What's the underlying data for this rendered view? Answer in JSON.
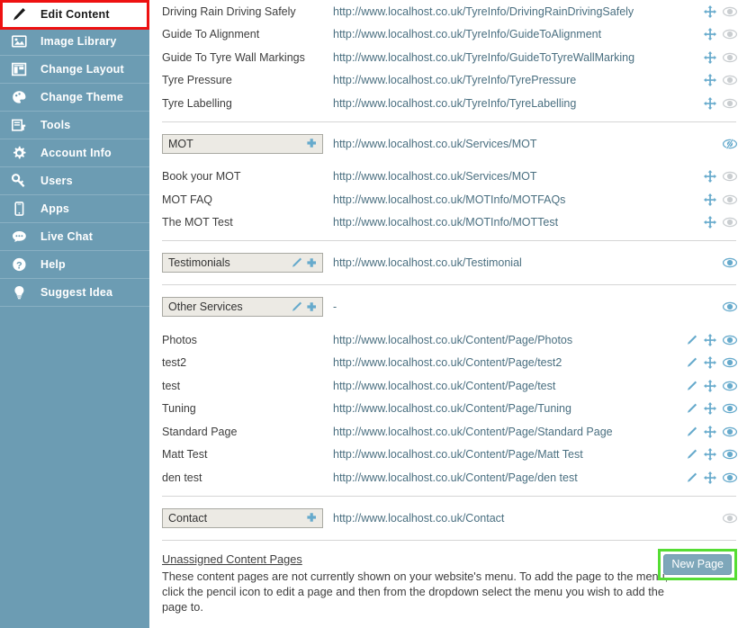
{
  "sidebar": {
    "items": [
      {
        "label": "Edit Content",
        "icon": "pencil-icon",
        "active": true
      },
      {
        "label": "Image Library",
        "icon": "image-icon",
        "active": false
      },
      {
        "label": "Change Layout",
        "icon": "layout-icon",
        "active": false
      },
      {
        "label": "Change Theme",
        "icon": "paint-icon",
        "active": false
      },
      {
        "label": "Tools",
        "icon": "tools-icon",
        "active": false
      },
      {
        "label": "Account Info",
        "icon": "gear-icon",
        "active": false
      },
      {
        "label": "Users",
        "icon": "key-icon",
        "active": false
      },
      {
        "label": "Apps",
        "icon": "mobile-icon",
        "active": false
      },
      {
        "label": "Live Chat",
        "icon": "chat-bubble-icon",
        "active": false
      },
      {
        "label": "Help",
        "icon": "question-mark-icon",
        "active": false
      },
      {
        "label": "Suggest Idea",
        "icon": "lightbulb-icon",
        "active": false
      }
    ]
  },
  "colors": {
    "sidebar_bg": "#6c9cb3",
    "accent_blue": "#66aacc",
    "link_blue": "#4a6f80",
    "highlight_red": "#ee1111",
    "highlight_green": "#55dd33",
    "header_box_bg": "#eceae4"
  },
  "content": {
    "top_rows": [
      {
        "name": "Driving Rain Driving Safely",
        "url": "http://www.localhost.co.uk/TyreInfo/DrivingRainDrivingSafely",
        "icons": [
          "move-icon",
          "eye-icon-gray"
        ]
      },
      {
        "name": "Guide To Alignment",
        "url": "http://www.localhost.co.uk/TyreInfo/GuideToAlignment",
        "icons": [
          "move-icon",
          "eye-icon-gray"
        ]
      },
      {
        "name": "Guide To Tyre Wall Markings",
        "url": "http://www.localhost.co.uk/TyreInfo/GuideToTyreWallMarking",
        "icons": [
          "move-icon",
          "eye-icon-gray"
        ]
      },
      {
        "name": "Tyre Pressure",
        "url": "http://www.localhost.co.uk/TyreInfo/TyrePressure",
        "icons": [
          "move-icon",
          "eye-icon-gray"
        ]
      },
      {
        "name": "Tyre Labelling",
        "url": "http://www.localhost.co.uk/TyreInfo/TyreLabelling",
        "icons": [
          "move-icon",
          "eye-icon-gray"
        ]
      }
    ],
    "sections": [
      {
        "header": {
          "title": "MOT",
          "url": "http://www.localhost.co.uk/Services/MOT",
          "box_icons": [
            "plus-icon"
          ],
          "row_icons": [
            "eye-slash-icon-blue"
          ]
        },
        "children": [
          {
            "name": "Book your MOT",
            "url": "http://www.localhost.co.uk/Services/MOT",
            "icons": [
              "move-icon",
              "eye-icon-gray"
            ]
          },
          {
            "name": "MOT FAQ",
            "url": "http://www.localhost.co.uk/MOTInfo/MOTFAQs",
            "icons": [
              "move-icon",
              "eye-icon-gray"
            ]
          },
          {
            "name": "The MOT Test",
            "url": "http://www.localhost.co.uk/MOTInfo/MOTTest",
            "icons": [
              "move-icon",
              "eye-icon-gray"
            ]
          }
        ]
      },
      {
        "header": {
          "title": "Testimonials",
          "url": "http://www.localhost.co.uk/Testimonial",
          "box_icons": [
            "pencil-icon",
            "plus-icon"
          ],
          "row_icons": [
            "eye-icon-blue"
          ]
        },
        "children": []
      },
      {
        "header": {
          "title": "Other Services",
          "url": "-",
          "box_icons": [
            "pencil-icon",
            "plus-icon"
          ],
          "row_icons": [
            "eye-icon-blue"
          ]
        },
        "children": [
          {
            "name": "Photos",
            "url": "http://www.localhost.co.uk/Content/Page/Photos",
            "icons": [
              "pencil-icon",
              "move-icon",
              "eye-icon-blue"
            ]
          },
          {
            "name": "test2",
            "url": "http://www.localhost.co.uk/Content/Page/test2",
            "icons": [
              "pencil-icon",
              "move-icon",
              "eye-icon-blue"
            ]
          },
          {
            "name": "test",
            "url": "http://www.localhost.co.uk/Content/Page/test",
            "icons": [
              "pencil-icon",
              "move-icon",
              "eye-icon-blue"
            ]
          },
          {
            "name": "Tuning",
            "url": "http://www.localhost.co.uk/Content/Page/Tuning",
            "icons": [
              "pencil-icon",
              "move-icon",
              "eye-icon-blue"
            ]
          },
          {
            "name": "Standard Page",
            "url": "http://www.localhost.co.uk/Content/Page/Standard Page",
            "icons": [
              "pencil-icon",
              "move-icon",
              "eye-icon-blue"
            ]
          },
          {
            "name": "Matt Test",
            "url": "http://www.localhost.co.uk/Content/Page/Matt Test",
            "icons": [
              "pencil-icon",
              "move-icon",
              "eye-icon-blue"
            ]
          },
          {
            "name": "den test",
            "url": "http://www.localhost.co.uk/Content/Page/den test",
            "icons": [
              "pencil-icon",
              "move-icon",
              "eye-icon-blue"
            ]
          }
        ]
      },
      {
        "header": {
          "title": "Contact",
          "url": "http://www.localhost.co.uk/Contact",
          "box_icons": [
            "plus-icon"
          ],
          "row_icons": [
            "eye-icon-gray"
          ]
        },
        "children": []
      }
    ]
  },
  "footer": {
    "link": "Unassigned Content Pages",
    "description": "These content pages are not currently shown on your website's menu. To add the page to the menu, click the pencil icon to edit a page and then from the dropdown select the menu you wish to add the page to.",
    "new_page_button": "New Page"
  }
}
